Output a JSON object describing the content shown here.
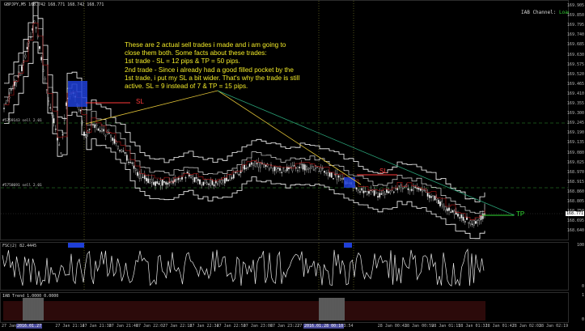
{
  "chart": {
    "symbol_info": "GBPJPY,M5  168.742 168.771 168.742 168.771",
    "channel_status_label": "IAB Channel:",
    "channel_status_value": "Loaded",
    "colors": {
      "background": "#000000",
      "candles": "#bfbfbf",
      "channel": "#ffffff",
      "sell_box": "#1f3fd8",
      "stop_loss": "#ff3a3a",
      "take_profit": "#33dd33",
      "trend_line_1": "#e2c437",
      "trend_line_2": "#2aa378",
      "order_level": "#2e9a2e",
      "session_separator": "#9ea33a",
      "trend_bar": "#6e1a1a"
    }
  },
  "annotation": {
    "lines": [
      "These are 2 actual sell trades i made and i am going to",
      "close them both. Some facts about these trades:",
      "1st trade - SL = 12 pips & TP = 50 pips.",
      "2nd trade - Since i already had a good filled pocket by the",
      "1st trade, i put my SL a bit wider. That's why the trade is still",
      "active. SL = 9 instead of 7 & TP = 15 pips."
    ]
  },
  "labels": {
    "sl_1": "SL",
    "sl_2": "SL",
    "tp": "TP",
    "order_1": "#5759143 sell 2.01",
    "order_2": "#5758691 sell 2.01"
  },
  "price_axis": {
    "labels": [
      "169.905",
      "169.850",
      "169.795",
      "169.740",
      "169.685",
      "169.630",
      "169.575",
      "169.520",
      "169.465",
      "169.410",
      "169.355",
      "169.300",
      "169.245",
      "169.190",
      "169.135",
      "169.080",
      "169.025",
      "168.970",
      "168.915",
      "168.860",
      "168.805",
      "168.750",
      "168.695",
      "168.640"
    ],
    "current_price": "168.771"
  },
  "oscillator": {
    "title": "FSC(2) 82.4445",
    "labels": [
      "100",
      "0"
    ]
  },
  "trend_indicator": {
    "title": "IAB Trend 1.0000 0.0000",
    "labels": [
      "1",
      "0"
    ]
  },
  "time_axis": {
    "labels": [
      {
        "text": "27 Jan 2016",
        "hl": false
      },
      {
        "text": "2016.01.27",
        "hl": true
      },
      {
        "text": "27 Jan 21:14",
        "hl": false
      },
      {
        "text": "27 Jan 21:30",
        "hl": false
      },
      {
        "text": "27 Jan 21:46",
        "hl": false
      },
      {
        "text": "27 Jan 22:02",
        "hl": false
      },
      {
        "text": "27 Jan 22:18",
        "hl": false
      },
      {
        "text": "27 Jan 22:34",
        "hl": false
      },
      {
        "text": "27 Jan 22:50",
        "hl": false
      },
      {
        "text": "27 Jan 23:06",
        "hl": false
      },
      {
        "text": "27 Jan 23:22",
        "hl": false
      },
      {
        "text": "27 Jan 23:38",
        "hl": false
      },
      {
        "text": "27 Jan 23:54",
        "hl": false
      },
      {
        "text": "2016.01.28 00:10",
        "hl": true
      },
      {
        "text": "28 Jan 00:43",
        "hl": false
      },
      {
        "text": "28 Jan 00:59",
        "hl": false
      },
      {
        "text": "28 Jan 01:15",
        "hl": false
      },
      {
        "text": "28 Jan 01:31",
        "hl": false
      },
      {
        "text": "28 Jan 01:47",
        "hl": false
      },
      {
        "text": "28 Jan 02:03",
        "hl": false
      },
      {
        "text": "28 Jan 02:19",
        "hl": false
      }
    ]
  }
}
